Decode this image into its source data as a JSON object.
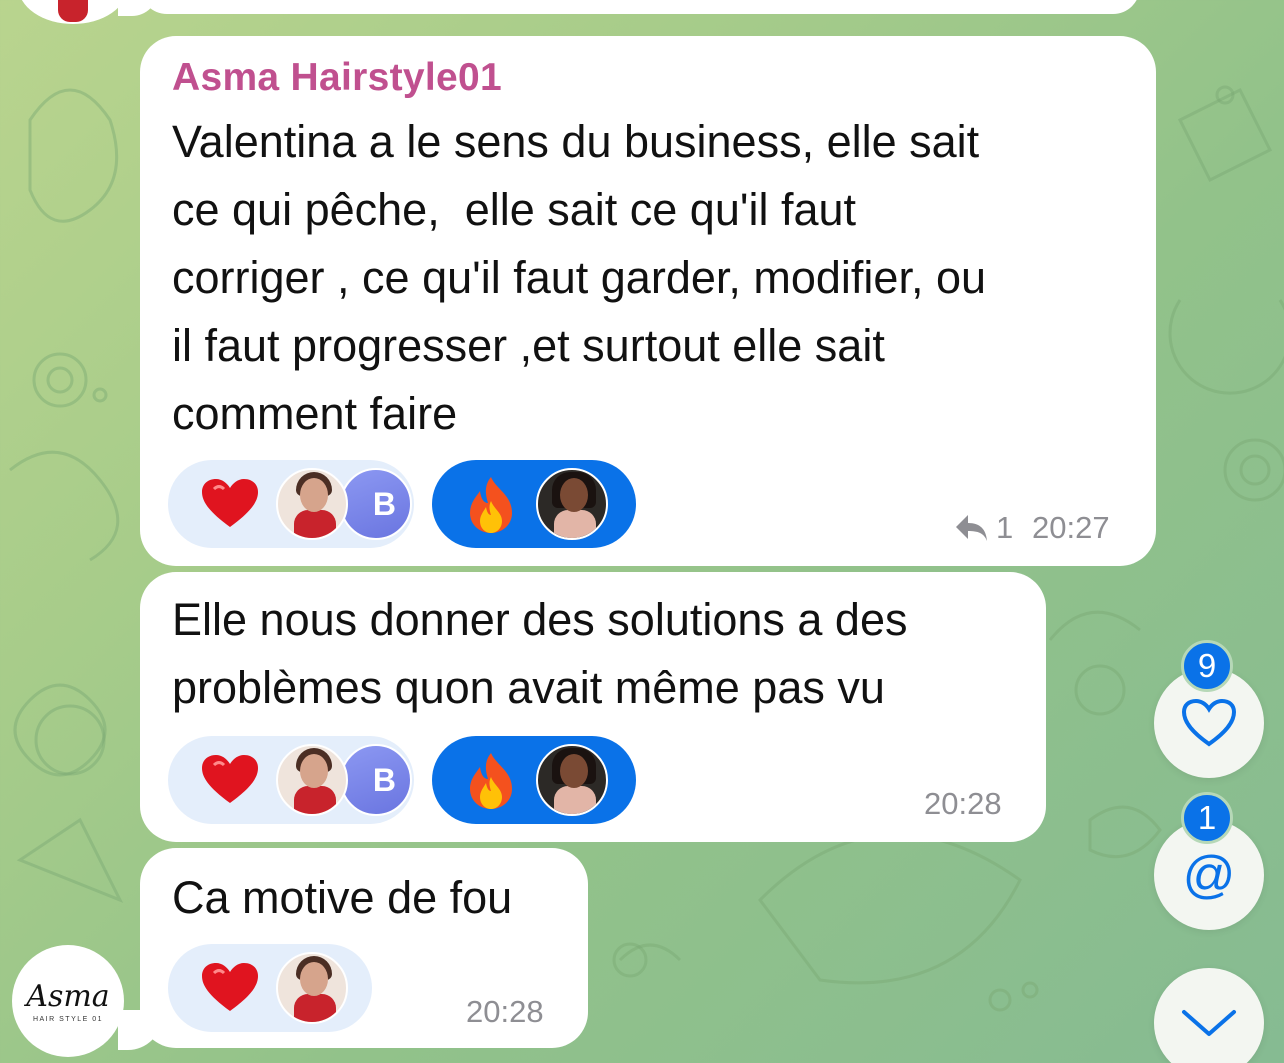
{
  "messages": [
    {
      "sender": "Asma Hairstyle01",
      "text": "Valentina a le sens du business, elle sait\nce qui pêche,  elle sait ce qu'il faut\ncorriger , ce qu'il faut garder, modifier, ou\nil faut progresser ,et surtout elle sait\ncomment faire",
      "time": "20:27",
      "reply_count": "1",
      "reactions": [
        {
          "emoji": "heart",
          "avatars": [
            "photo-woman",
            "B"
          ],
          "selected": false
        },
        {
          "emoji": "fire",
          "avatars": [
            "photo-woman-2"
          ],
          "selected": true
        }
      ]
    },
    {
      "text": "Elle nous donner des solutions a des\nproblèmes quon avait même pas vu",
      "time": "20:28",
      "reactions": [
        {
          "emoji": "heart",
          "avatars": [
            "photo-woman",
            "B"
          ],
          "selected": false
        },
        {
          "emoji": "fire",
          "avatars": [
            "photo-woman-2"
          ],
          "selected": true
        }
      ]
    },
    {
      "text": "Ca motive de fou",
      "time": "20:28",
      "reactions": [
        {
          "emoji": "heart",
          "avatars": [
            "photo-woman"
          ],
          "selected": false
        }
      ]
    }
  ],
  "reaction_avatar_letter": "B",
  "sender_logo": {
    "script": "Asma",
    "subtitle": "HAIR STYLE 01"
  },
  "side_buttons": {
    "reactions_badge": "9",
    "mentions_badge": "1",
    "mention_symbol": "@"
  },
  "colors": {
    "sender_name": "#c0508f",
    "accent_blue": "#0a72e8",
    "reaction_pill": "#e4eefb",
    "time_gray": "#8e8e93"
  }
}
